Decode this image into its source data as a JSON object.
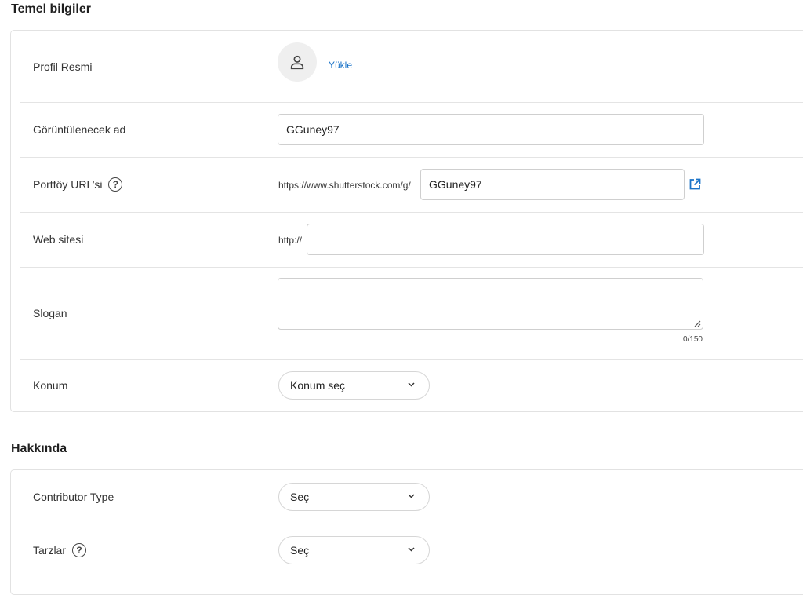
{
  "basic_info": {
    "title": "Temel bilgiler",
    "profile_picture": {
      "label": "Profil Resmi",
      "upload_label": "Yükle",
      "icon": "user-icon"
    },
    "display_name": {
      "label": "Görüntülenecek ad",
      "value": "GGuney97"
    },
    "portfolio_url": {
      "label": "Portföy URL’si",
      "help_icon": "question-circle-icon",
      "prefix": "https://www.shutterstock.com/g/",
      "value": "GGuney97",
      "open_icon": "external-link-icon"
    },
    "website": {
      "label": "Web sitesi",
      "prefix": "http://",
      "value": ""
    },
    "slogan": {
      "label": "Slogan",
      "value": "",
      "counter": "0/150"
    },
    "location": {
      "label": "Konum",
      "selected": "Konum seç"
    }
  },
  "about": {
    "title": "Hakkında",
    "contributor_type": {
      "label": "Contributor Type",
      "selected": "Seç"
    },
    "styles": {
      "label": "Tarzlar",
      "help_icon": "question-circle-icon",
      "selected": "Seç"
    }
  },
  "colors": {
    "link": "#1a73c8",
    "border": "#e2e2e2",
    "avatar_bg": "#efefef"
  }
}
